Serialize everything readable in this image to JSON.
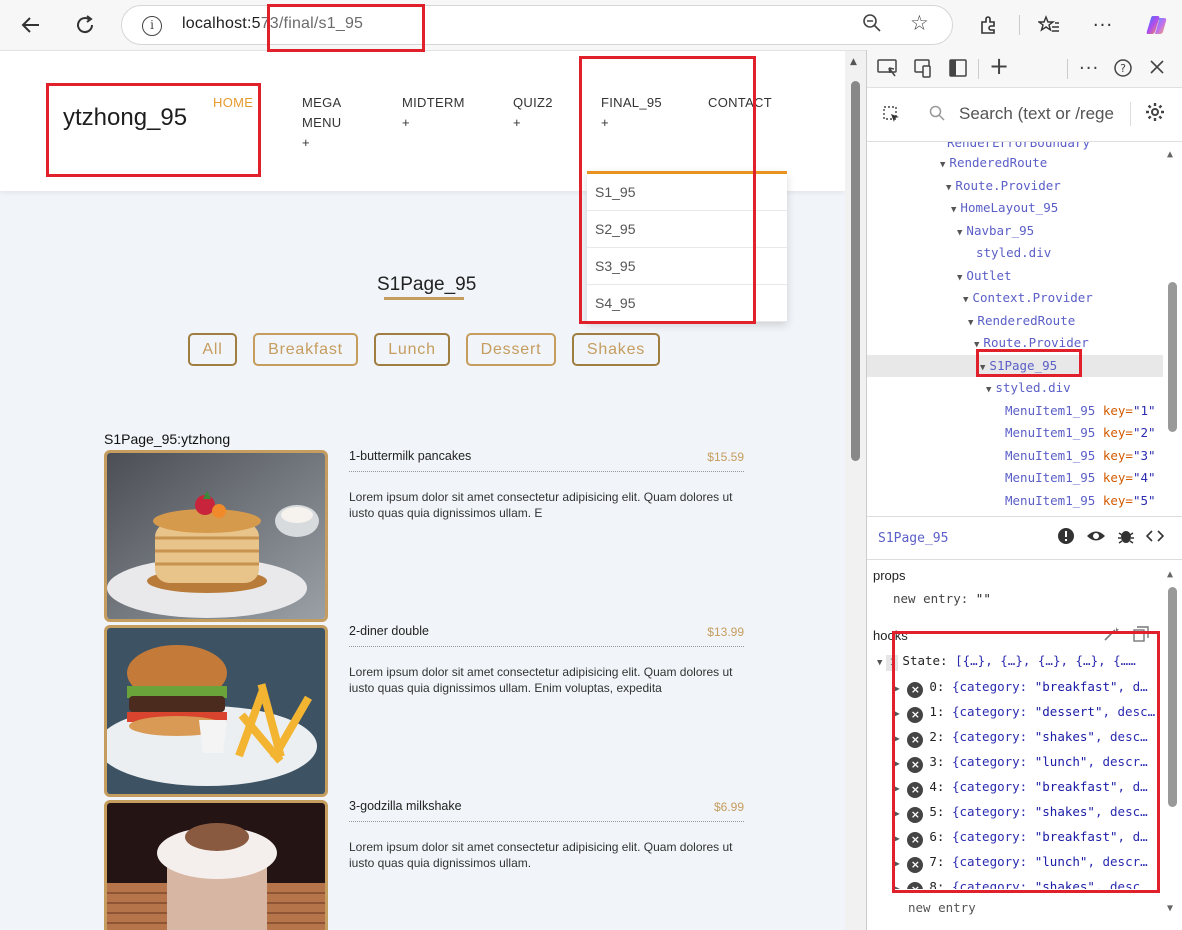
{
  "browser": {
    "url_host": "localhost:5",
    "url_path": "73/final/s1_95",
    "back_icon": "arrow-left-icon",
    "reload_icon": "reload-icon"
  },
  "navbar": {
    "brand": "ytzhong_95",
    "items": [
      {
        "label": "HOME"
      },
      {
        "label": "MEGA\nMENU\n+"
      },
      {
        "label": "MIDTERM\n+"
      },
      {
        "label": "QUIZ2\n+"
      },
      {
        "label": "FINAL_95\n+"
      },
      {
        "label": "CONTACT"
      }
    ],
    "dropdown": [
      "S1_95",
      "S2_95",
      "S3_95",
      "S4_95"
    ]
  },
  "page": {
    "title": "S1Page_95",
    "filters": [
      "All",
      "Breakfast",
      "Lunch",
      "Dessert",
      "Shakes"
    ],
    "section_label": "S1Page_95:ytzhong",
    "items": [
      {
        "title": "1-buttermilk pancakes",
        "price": "$15.59",
        "desc": "Lorem ipsum dolor sit amet consectetur adipisicing elit. Quam dolores ut iusto quas quia dignissimos ullam. E"
      },
      {
        "title": "2-diner double",
        "price": "$13.99",
        "desc": "Lorem ipsum dolor sit amet consectetur adipisicing elit. Quam dolores ut iusto quas quia dignissimos ullam. Enim voluptas, expedita"
      },
      {
        "title": "3-godzilla milkshake",
        "price": "$6.99",
        "desc": "Lorem ipsum dolor sit amet consectetur adipisicing elit. Quam dolores ut iusto quas quia dignissimos ullam."
      }
    ]
  },
  "devtools": {
    "search_placeholder": "Search (text or /rege",
    "tree": [
      {
        "label": "RenderErrorBoundary",
        "tri": ""
      },
      {
        "label": "RenderedRoute",
        "tri": "▼"
      },
      {
        "label": "Route.Provider",
        "tri": "▼"
      },
      {
        "label": "HomeLayout_95",
        "tri": "▼"
      },
      {
        "label": "Navbar_95",
        "tri": "▼"
      },
      {
        "label": "styled.div",
        "tri": ""
      },
      {
        "label": "Outlet",
        "tri": "▼"
      },
      {
        "label": "Context.Provider",
        "tri": "▼"
      },
      {
        "label": "RenderedRoute",
        "tri": "▼"
      },
      {
        "label": "Route.Provider",
        "tri": "▼"
      },
      {
        "label": "S1Page_95",
        "tri": "▼"
      },
      {
        "label": "styled.div",
        "tri": "▼"
      },
      {
        "label": "MenuItem1_95",
        "key": "key=",
        "val": "\"1\""
      },
      {
        "label": "MenuItem1_95",
        "key": "key=",
        "val": "\"2\""
      },
      {
        "label": "MenuItem1_95",
        "key": "key=",
        "val": "\"3\""
      },
      {
        "label": "MenuItem1_95",
        "key": "key=",
        "val": "\"4\""
      },
      {
        "label": "MenuItem1_95",
        "key": "key=",
        "val": "\"5\""
      }
    ],
    "selected_component": "S1Page_95",
    "props_label": "props",
    "props_entry_key": "new entry",
    "props_entry_val": "\"\"",
    "hooks_label": "hooks",
    "state_num": "1",
    "state_label": "State:",
    "state_value": "[{…}, {…}, {…}, {…}, {……",
    "hooks": [
      {
        "idx": "0:",
        "pre": "{category: ",
        "cat": "\"breakfast\"",
        "post": ", d…"
      },
      {
        "idx": "1:",
        "pre": "{category: ",
        "cat": "\"dessert\"",
        "post": ", desc…"
      },
      {
        "idx": "2:",
        "pre": "{category: ",
        "cat": "\"shakes\"",
        "post": ", desc…"
      },
      {
        "idx": "3:",
        "pre": "{category: ",
        "cat": "\"lunch\"",
        "post": ", descr…"
      },
      {
        "idx": "4:",
        "pre": "{category: ",
        "cat": "\"breakfast\"",
        "post": ", d…"
      },
      {
        "idx": "5:",
        "pre": "{category: ",
        "cat": "\"shakes\"",
        "post": ", desc…"
      },
      {
        "idx": "6:",
        "pre": "{category: ",
        "cat": "\"breakfast\"",
        "post": ", d…"
      },
      {
        "idx": "7:",
        "pre": "{category: ",
        "cat": "\"lunch\"",
        "post": ", descr…"
      },
      {
        "idx": "8:",
        "pre": "{category: ",
        "cat": "\"shakes\"",
        "post": ", desc…"
      }
    ],
    "new_entry": "new entry"
  },
  "colors": {
    "accent": "#c59d5f",
    "active_nav": "#e59a2e",
    "annotation": "#e0202b"
  }
}
